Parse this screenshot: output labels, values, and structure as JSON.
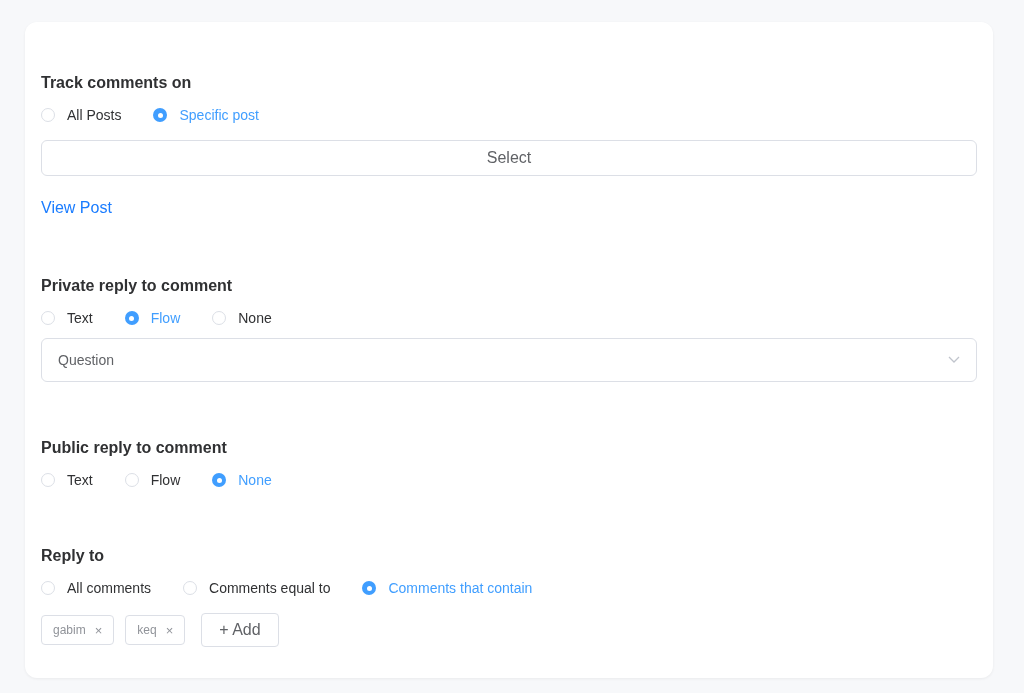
{
  "sections": [
    {
      "title": "Track comments on",
      "options": [
        {
          "label": "All Posts",
          "selected": false
        },
        {
          "label": "Specific post",
          "selected": true
        }
      ],
      "select_button": "Select",
      "link": "View Post"
    },
    {
      "title": "Private reply to comment",
      "options": [
        {
          "label": "Text",
          "selected": false
        },
        {
          "label": "Flow",
          "selected": true
        },
        {
          "label": "None",
          "selected": false
        }
      ],
      "dropdown": {
        "value": "Question"
      }
    },
    {
      "title": "Public reply to comment",
      "options": [
        {
          "label": "Text",
          "selected": false
        },
        {
          "label": "Flow",
          "selected": false
        },
        {
          "label": "None",
          "selected": true
        }
      ]
    },
    {
      "title": "Reply to",
      "options": [
        {
          "label": "All comments",
          "selected": false
        },
        {
          "label": "Comments equal to",
          "selected": false
        },
        {
          "label": "Comments that contain",
          "selected": true
        }
      ],
      "tags": [
        {
          "label": "gabim",
          "remove": "×"
        },
        {
          "label": "keq",
          "remove": "×"
        }
      ],
      "add_button": "+ Add"
    }
  ]
}
